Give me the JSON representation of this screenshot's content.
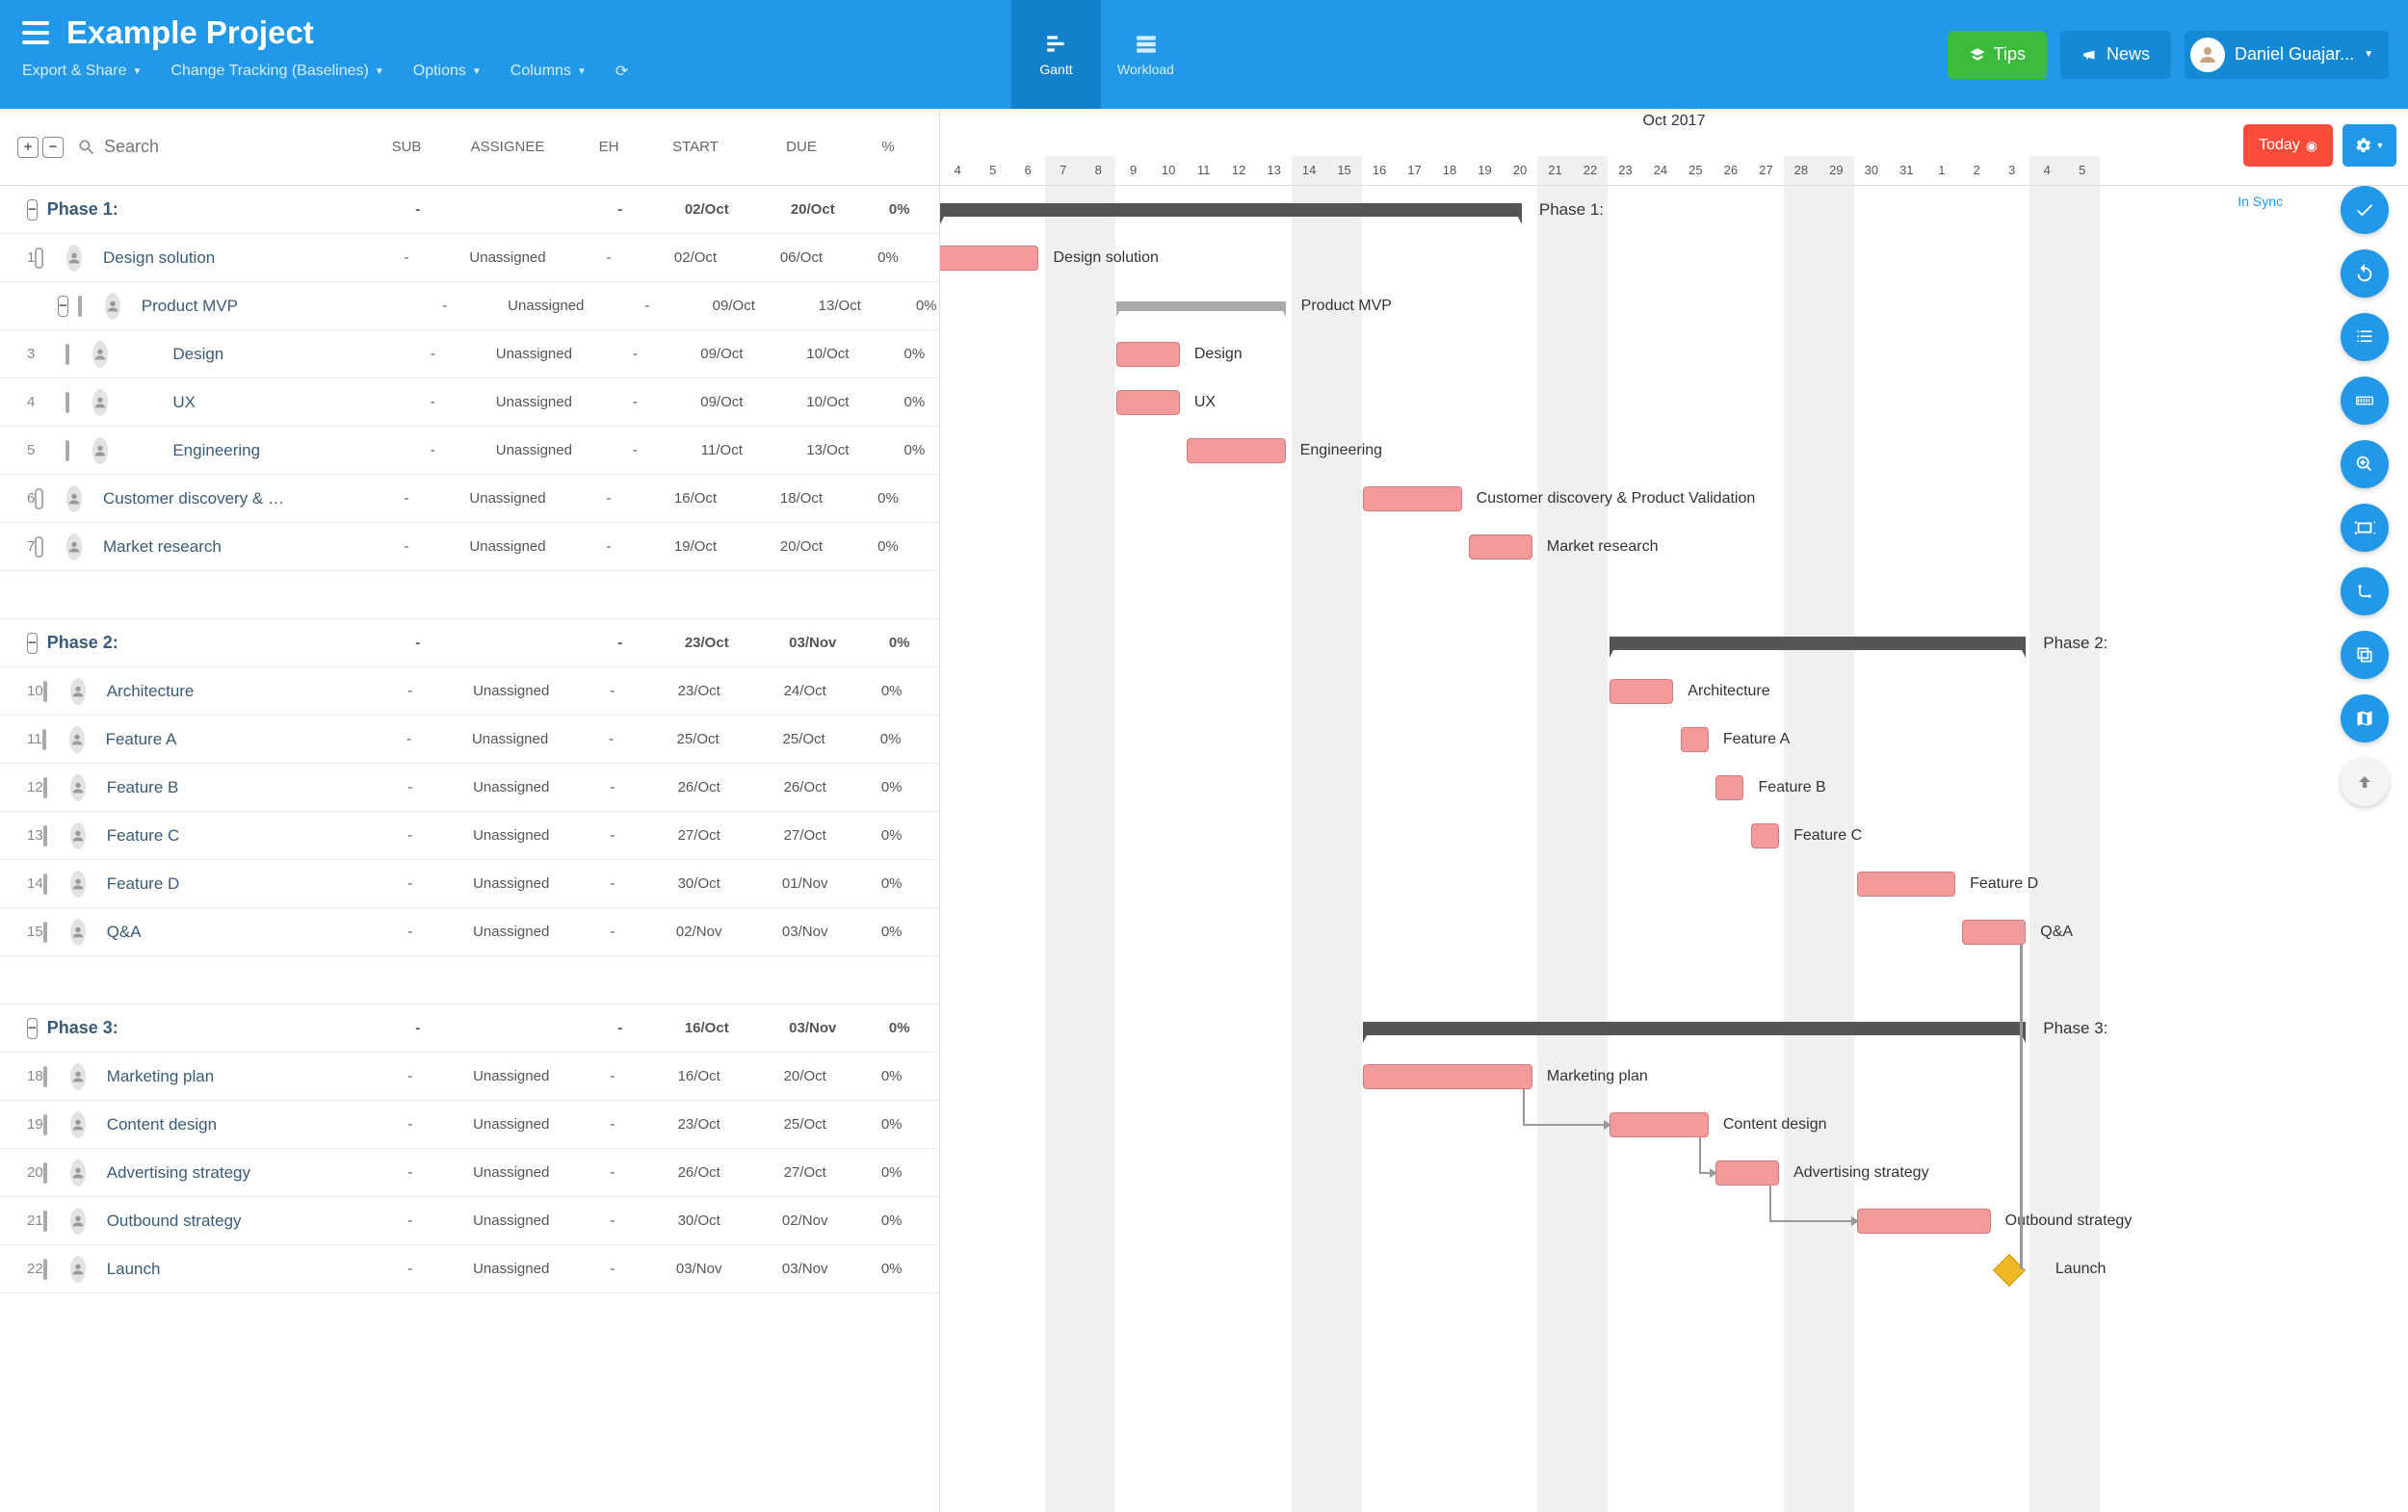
{
  "header": {
    "project_title": "Example Project",
    "menu": {
      "export": "Export & Share",
      "tracking": "Change Tracking (Baselines)",
      "options": "Options",
      "columns": "Columns"
    },
    "views": {
      "gantt": "Gantt",
      "workload": "Workload"
    },
    "tips": "Tips",
    "news": "News",
    "user": "Daniel Guajar..."
  },
  "toolbar": {
    "search_placeholder": "Search",
    "cols": {
      "sub": "SUB",
      "assignee": "ASSIGNEE",
      "eh": "EH",
      "start": "START",
      "due": "DUE",
      "pct": "%"
    },
    "month": "Oct 2017",
    "days": [
      "4",
      "5",
      "6",
      "7",
      "8",
      "9",
      "10",
      "11",
      "12",
      "13",
      "14",
      "15",
      "16",
      "17",
      "18",
      "19",
      "20",
      "21",
      "22",
      "23",
      "24",
      "25",
      "26",
      "27",
      "28",
      "29",
      "30",
      "31",
      "1",
      "2",
      "3",
      "4",
      "5"
    ],
    "weekend_idx": [
      3,
      4,
      10,
      11,
      17,
      18,
      24,
      25,
      31,
      32
    ],
    "today": "Today"
  },
  "insync": "In Sync",
  "col_w": 36.6,
  "rows": [
    {
      "type": "phase",
      "name": "Phase 1:",
      "sub": "-",
      "start": "02/Oct",
      "due": "20/Oct",
      "pct": "0%",
      "g_start": 0,
      "g_end": 16.5,
      "label_right": true
    },
    {
      "type": "task",
      "num": "1",
      "name": "Design solution",
      "assignee": "Unassigned",
      "sub": "-",
      "start": "02/Oct",
      "due": "06/Oct",
      "pct": "0%",
      "g_start": -1.6,
      "g_end": 2.8
    },
    {
      "type": "subphase",
      "num": "",
      "name": "Product MVP",
      "assignee": "Unassigned",
      "sub": "-",
      "start": "09/Oct",
      "due": "13/Oct",
      "pct": "0%",
      "g_start": 5,
      "g_end": 9.8
    },
    {
      "type": "task",
      "num": "3",
      "name": "Design",
      "indent": 1,
      "assignee": "Unassigned",
      "sub": "-",
      "start": "09/Oct",
      "due": "10/Oct",
      "pct": "0%",
      "g_start": 5,
      "g_end": 6.8
    },
    {
      "type": "task",
      "num": "4",
      "name": "UX",
      "indent": 1,
      "assignee": "Unassigned",
      "sub": "-",
      "start": "09/Oct",
      "due": "10/Oct",
      "pct": "0%",
      "g_start": 5,
      "g_end": 6.8
    },
    {
      "type": "task",
      "num": "5",
      "name": "Engineering",
      "indent": 1,
      "assignee": "Unassigned",
      "sub": "-",
      "start": "11/Oct",
      "due": "13/Oct",
      "pct": "0%",
      "g_start": 7,
      "g_end": 9.8
    },
    {
      "type": "task",
      "num": "6",
      "name": "Customer discovery & …",
      "full": "Customer discovery & Product Validation",
      "assignee": "Unassigned",
      "sub": "-",
      "start": "16/Oct",
      "due": "18/Oct",
      "pct": "0%",
      "g_start": 12,
      "g_end": 14.8
    },
    {
      "type": "task",
      "num": "7",
      "name": "Market research",
      "assignee": "Unassigned",
      "sub": "-",
      "start": "19/Oct",
      "due": "20/Oct",
      "pct": "0%",
      "g_start": 15,
      "g_end": 16.8
    },
    {
      "type": "spacer"
    },
    {
      "type": "phase",
      "name": "Phase 2:",
      "sub": "-",
      "start": "23/Oct",
      "due": "03/Nov",
      "pct": "0%",
      "g_start": 19,
      "g_end": 30.8,
      "label_right": true
    },
    {
      "type": "task",
      "num": "10",
      "name": "Architecture",
      "assignee": "Unassigned",
      "sub": "-",
      "start": "23/Oct",
      "due": "24/Oct",
      "pct": "0%",
      "g_start": 19,
      "g_end": 20.8
    },
    {
      "type": "task",
      "num": "11",
      "name": "Feature A",
      "assignee": "Unassigned",
      "sub": "-",
      "start": "25/Oct",
      "due": "25/Oct",
      "pct": "0%",
      "g_start": 21,
      "g_end": 21.8
    },
    {
      "type": "task",
      "num": "12",
      "name": "Feature B",
      "assignee": "Unassigned",
      "sub": "-",
      "start": "26/Oct",
      "due": "26/Oct",
      "pct": "0%",
      "g_start": 22,
      "g_end": 22.8
    },
    {
      "type": "task",
      "num": "13",
      "name": "Feature C",
      "assignee": "Unassigned",
      "sub": "-",
      "start": "27/Oct",
      "due": "27/Oct",
      "pct": "0%",
      "g_start": 23,
      "g_end": 23.8
    },
    {
      "type": "task",
      "num": "14",
      "name": "Feature D",
      "assignee": "Unassigned",
      "sub": "-",
      "start": "30/Oct",
      "due": "01/Nov",
      "pct": "0%",
      "g_start": 26,
      "g_end": 28.8
    },
    {
      "type": "task",
      "num": "15",
      "name": "Q&A",
      "assignee": "Unassigned",
      "sub": "-",
      "start": "02/Nov",
      "due": "03/Nov",
      "pct": "0%",
      "g_start": 29,
      "g_end": 30.8
    },
    {
      "type": "spacer"
    },
    {
      "type": "phase",
      "name": "Phase 3:",
      "sub": "-",
      "start": "16/Oct",
      "due": "03/Nov",
      "pct": "0%",
      "g_start": 12,
      "g_end": 30.8,
      "label_right": true
    },
    {
      "type": "task",
      "num": "18",
      "name": "Marketing plan",
      "assignee": "Unassigned",
      "sub": "-",
      "start": "16/Oct",
      "due": "20/Oct",
      "pct": "0%",
      "g_start": 12,
      "g_end": 16.8,
      "dep_to": 19
    },
    {
      "type": "task",
      "num": "19",
      "name": "Content design",
      "assignee": "Unassigned",
      "sub": "-",
      "start": "23/Oct",
      "due": "25/Oct",
      "pct": "0%",
      "g_start": 19,
      "g_end": 21.8,
      "dep_to": 20
    },
    {
      "type": "task",
      "num": "20",
      "name": "Advertising strategy",
      "assignee": "Unassigned",
      "sub": "-",
      "start": "26/Oct",
      "due": "27/Oct",
      "pct": "0%",
      "g_start": 22,
      "g_end": 23.8,
      "dep_to": 21
    },
    {
      "type": "task",
      "num": "21",
      "name": "Outbound strategy",
      "assignee": "Unassigned",
      "sub": "-",
      "start": "30/Oct",
      "due": "02/Nov",
      "pct": "0%",
      "g_start": 26,
      "g_end": 29.8
    },
    {
      "type": "milestone",
      "num": "22",
      "name": "Launch",
      "assignee": "Unassigned",
      "sub": "-",
      "start": "03/Nov",
      "due": "03/Nov",
      "pct": "0%",
      "g_start": 30
    }
  ]
}
